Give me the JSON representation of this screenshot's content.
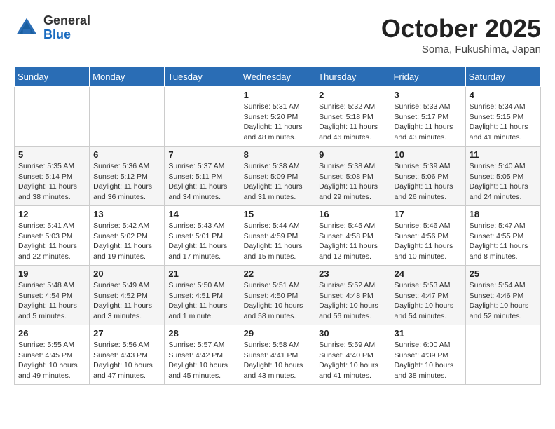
{
  "logo": {
    "general": "General",
    "blue": "Blue"
  },
  "title": "October 2025",
  "location": "Soma, Fukushima, Japan",
  "days_of_week": [
    "Sunday",
    "Monday",
    "Tuesday",
    "Wednesday",
    "Thursday",
    "Friday",
    "Saturday"
  ],
  "weeks": [
    [
      {
        "day": "",
        "info": ""
      },
      {
        "day": "",
        "info": ""
      },
      {
        "day": "",
        "info": ""
      },
      {
        "day": "1",
        "info": "Sunrise: 5:31 AM\nSunset: 5:20 PM\nDaylight: 11 hours\nand 48 minutes."
      },
      {
        "day": "2",
        "info": "Sunrise: 5:32 AM\nSunset: 5:18 PM\nDaylight: 11 hours\nand 46 minutes."
      },
      {
        "day": "3",
        "info": "Sunrise: 5:33 AM\nSunset: 5:17 PM\nDaylight: 11 hours\nand 43 minutes."
      },
      {
        "day": "4",
        "info": "Sunrise: 5:34 AM\nSunset: 5:15 PM\nDaylight: 11 hours\nand 41 minutes."
      }
    ],
    [
      {
        "day": "5",
        "info": "Sunrise: 5:35 AM\nSunset: 5:14 PM\nDaylight: 11 hours\nand 38 minutes."
      },
      {
        "day": "6",
        "info": "Sunrise: 5:36 AM\nSunset: 5:12 PM\nDaylight: 11 hours\nand 36 minutes."
      },
      {
        "day": "7",
        "info": "Sunrise: 5:37 AM\nSunset: 5:11 PM\nDaylight: 11 hours\nand 34 minutes."
      },
      {
        "day": "8",
        "info": "Sunrise: 5:38 AM\nSunset: 5:09 PM\nDaylight: 11 hours\nand 31 minutes."
      },
      {
        "day": "9",
        "info": "Sunrise: 5:38 AM\nSunset: 5:08 PM\nDaylight: 11 hours\nand 29 minutes."
      },
      {
        "day": "10",
        "info": "Sunrise: 5:39 AM\nSunset: 5:06 PM\nDaylight: 11 hours\nand 26 minutes."
      },
      {
        "day": "11",
        "info": "Sunrise: 5:40 AM\nSunset: 5:05 PM\nDaylight: 11 hours\nand 24 minutes."
      }
    ],
    [
      {
        "day": "12",
        "info": "Sunrise: 5:41 AM\nSunset: 5:03 PM\nDaylight: 11 hours\nand 22 minutes."
      },
      {
        "day": "13",
        "info": "Sunrise: 5:42 AM\nSunset: 5:02 PM\nDaylight: 11 hours\nand 19 minutes."
      },
      {
        "day": "14",
        "info": "Sunrise: 5:43 AM\nSunset: 5:01 PM\nDaylight: 11 hours\nand 17 minutes."
      },
      {
        "day": "15",
        "info": "Sunrise: 5:44 AM\nSunset: 4:59 PM\nDaylight: 11 hours\nand 15 minutes."
      },
      {
        "day": "16",
        "info": "Sunrise: 5:45 AM\nSunset: 4:58 PM\nDaylight: 11 hours\nand 12 minutes."
      },
      {
        "day": "17",
        "info": "Sunrise: 5:46 AM\nSunset: 4:56 PM\nDaylight: 11 hours\nand 10 minutes."
      },
      {
        "day": "18",
        "info": "Sunrise: 5:47 AM\nSunset: 4:55 PM\nDaylight: 11 hours\nand 8 minutes."
      }
    ],
    [
      {
        "day": "19",
        "info": "Sunrise: 5:48 AM\nSunset: 4:54 PM\nDaylight: 11 hours\nand 5 minutes."
      },
      {
        "day": "20",
        "info": "Sunrise: 5:49 AM\nSunset: 4:52 PM\nDaylight: 11 hours\nand 3 minutes."
      },
      {
        "day": "21",
        "info": "Sunrise: 5:50 AM\nSunset: 4:51 PM\nDaylight: 11 hours\nand 1 minute."
      },
      {
        "day": "22",
        "info": "Sunrise: 5:51 AM\nSunset: 4:50 PM\nDaylight: 10 hours\nand 58 minutes."
      },
      {
        "day": "23",
        "info": "Sunrise: 5:52 AM\nSunset: 4:48 PM\nDaylight: 10 hours\nand 56 minutes."
      },
      {
        "day": "24",
        "info": "Sunrise: 5:53 AM\nSunset: 4:47 PM\nDaylight: 10 hours\nand 54 minutes."
      },
      {
        "day": "25",
        "info": "Sunrise: 5:54 AM\nSunset: 4:46 PM\nDaylight: 10 hours\nand 52 minutes."
      }
    ],
    [
      {
        "day": "26",
        "info": "Sunrise: 5:55 AM\nSunset: 4:45 PM\nDaylight: 10 hours\nand 49 minutes."
      },
      {
        "day": "27",
        "info": "Sunrise: 5:56 AM\nSunset: 4:43 PM\nDaylight: 10 hours\nand 47 minutes."
      },
      {
        "day": "28",
        "info": "Sunrise: 5:57 AM\nSunset: 4:42 PM\nDaylight: 10 hours\nand 45 minutes."
      },
      {
        "day": "29",
        "info": "Sunrise: 5:58 AM\nSunset: 4:41 PM\nDaylight: 10 hours\nand 43 minutes."
      },
      {
        "day": "30",
        "info": "Sunrise: 5:59 AM\nSunset: 4:40 PM\nDaylight: 10 hours\nand 41 minutes."
      },
      {
        "day": "31",
        "info": "Sunrise: 6:00 AM\nSunset: 4:39 PM\nDaylight: 10 hours\nand 38 minutes."
      },
      {
        "day": "",
        "info": ""
      }
    ]
  ]
}
